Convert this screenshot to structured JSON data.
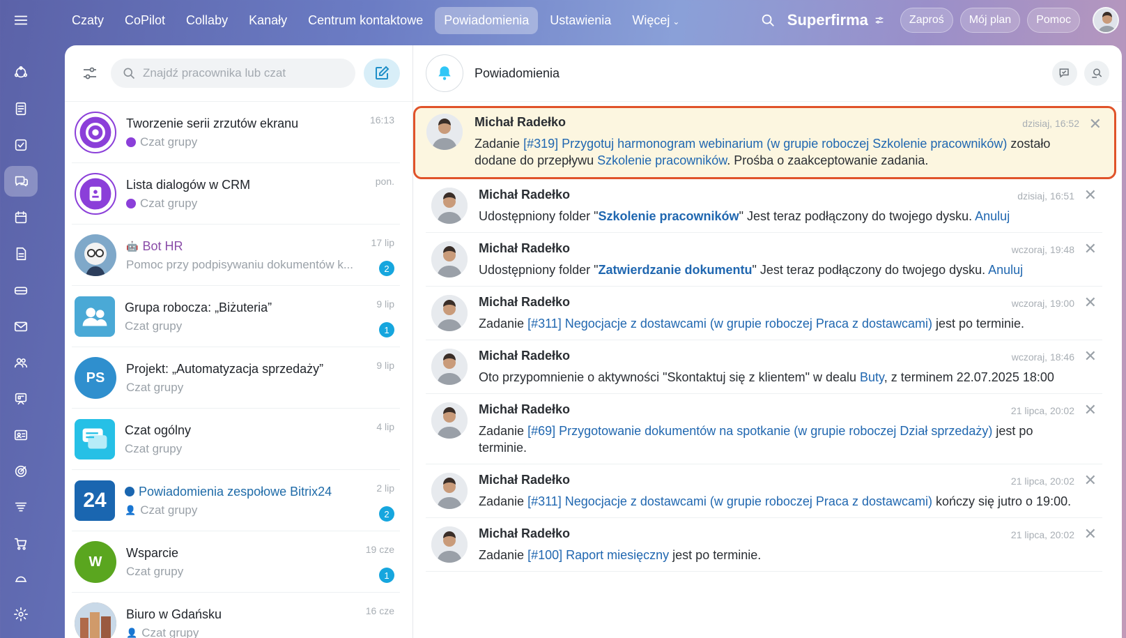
{
  "top_nav": {
    "items": [
      "Czaty",
      "CoPilot",
      "Collaby",
      "Kanały",
      "Centrum kontaktowe",
      "Powiadomienia",
      "Ustawienia",
      "Więcej"
    ],
    "active": "Powiadomienia"
  },
  "header_right": {
    "brand": "Superfirma",
    "invite": "Zaproś",
    "plan": "Mój plan",
    "help": "Pomoc"
  },
  "chat_search": {
    "placeholder": "Znajdź pracownika lub czat"
  },
  "chats": [
    {
      "name": "Tworzenie serii zrzutów ekranu",
      "sub": "Czat grupy",
      "time": "16:13",
      "badge": "",
      "avatar_color": "#8b3fd9"
    },
    {
      "name": "Lista dialogów w CRM",
      "sub": "Czat grupy",
      "time": "pon.",
      "badge": "",
      "avatar_color": "#8b3fd9"
    },
    {
      "name": "Bot HR",
      "sub": "Pomoc przy podpisywaniu dokumentów k...",
      "time": "17 lip",
      "badge": "2",
      "avatar_color": "#cfd8e3"
    },
    {
      "name": "Grupa robocza: „Biżuteria”",
      "sub": "Czat grupy",
      "time": "9 lip",
      "badge": "1",
      "avatar_color": "#4aa9d6"
    },
    {
      "name": "Projekt: „Automatyzacja sprzedaży”",
      "sub": "Czat grupy",
      "time": "9 lip",
      "badge": "",
      "avatar_color": "#2f8fce",
      "initials": "PS"
    },
    {
      "name": "Czat ogólny",
      "sub": "Czat grupy",
      "time": "4 lip",
      "badge": "",
      "avatar_color": "#26c0e6"
    },
    {
      "name": "Powiadomienia zespołowe Bitrix24",
      "sub": "Czat grupy",
      "time": "2 lip",
      "badge": "2",
      "avatar_color": "#1a66b0",
      "initials": "24"
    },
    {
      "name": "Wsparcie",
      "sub": "Czat grupy",
      "time": "19 cze",
      "badge": "1",
      "avatar_color": "#5aa61f",
      "initials": "W"
    },
    {
      "name": "Biuro w Gdańsku",
      "sub": "Czat grupy",
      "time": "16 cze",
      "badge": "",
      "avatar_color": "#b88a68"
    }
  ],
  "notifications_panel": {
    "title": "Powiadomienia"
  },
  "notifications": [
    {
      "author": "Michał Radełko",
      "time": "dzisiaj, 16:52",
      "p1": "Zadanie ",
      "l1": "[#319] Przygotuj harmonogram webinarium (w grupie roboczej Szkolenie pracowników)",
      "p2": " zostało dodane do przepływu ",
      "l2": "Szkolenie pracowników",
      "p3": ". Prośba o zaakceptowanie zadania."
    },
    {
      "author": "Michał Radełko",
      "time": "dzisiaj, 16:51",
      "p1": "Udostępniony folder \"",
      "l1": "Szkolenie pracowników",
      "p2": "\" Jest teraz podłączony do twojego dysku. ",
      "l2": "Anuluj"
    },
    {
      "author": "Michał Radełko",
      "time": "wczoraj, 19:48",
      "p1": "Udostępniony folder \"",
      "l1": "Zatwierdzanie dokumentu",
      "p2": "\" Jest teraz podłączony do twojego dysku. ",
      "l2": "Anuluj"
    },
    {
      "author": "Michał Radełko",
      "time": "wczoraj, 19:00",
      "p1": "Zadanie ",
      "l1": "[#311] Negocjacje z dostawcami (w grupie roboczej Praca z dostawcami)",
      "p2": " jest po terminie."
    },
    {
      "author": "Michał Radełko",
      "time": "wczoraj, 18:46",
      "p1": "Oto przypomnienie o aktywności \"Skontaktuj się z klientem\" w dealu ",
      "l1": "Buty",
      "p2": ", z terminem 22.07.2025 18:00"
    },
    {
      "author": "Michał Radełko",
      "time": "21 lipca, 20:02",
      "p1": "Zadanie ",
      "l1": "[#69] Przygotowanie dokumentów na spotkanie (w grupie roboczej Dział sprzedaży)",
      "p2": " jest po terminie."
    },
    {
      "author": "Michał Radełko",
      "time": "21 lipca, 20:02",
      "p1": "Zadanie ",
      "l1": "[#311] Negocjacje z dostawcami (w grupie roboczej Praca z dostawcami)",
      "p2": " kończy się jutro o 19:00."
    },
    {
      "author": "Michał Radełko",
      "time": "21 lipca, 20:02",
      "p1": "Zadanie ",
      "l1": "[#100] Raport miesięczny",
      "p2": " jest po terminie."
    }
  ],
  "colors": {
    "accent": "#2067b0",
    "highlight_border": "#e0532a",
    "highlight_bg": "#fcf6e0",
    "badge": "#16a6de"
  }
}
